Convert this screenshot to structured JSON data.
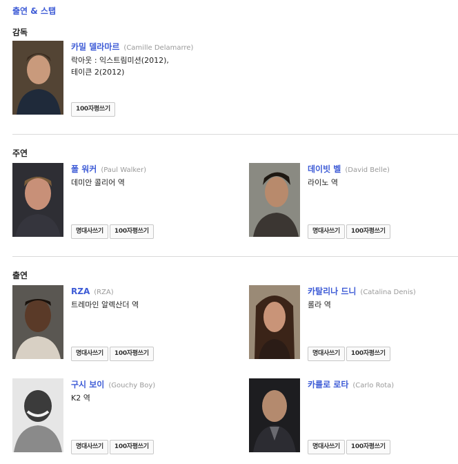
{
  "section": {
    "title": "출연 & 스탭"
  },
  "groups": {
    "director": "감독",
    "lead": "주연",
    "cast": "출연"
  },
  "buttons": {
    "quote": "명대사쓰기",
    "review": "100자평쓰기"
  },
  "people": [
    {
      "name": "카밀 델라마르",
      "en": "(Camille Delamarre)",
      "line1": "락아웃 : 익스트림미션(2012),",
      "line2": "테이큰 2(2012)"
    },
    {
      "name": "폴 워커",
      "en": "(Paul Walker)",
      "line1": "데미안 콜리어 역"
    },
    {
      "name": "데이빗 벨",
      "en": "(David Belle)",
      "line1": "라이노 역"
    },
    {
      "name": "RZA",
      "en": "(RZA)",
      "line1": "트레마인 알렉산더 역"
    },
    {
      "name": "카탈리나 드니",
      "en": "(Catalina Denis)",
      "line1": "롤라 역"
    },
    {
      "name": "구시 보이",
      "en": "(Gouchy Boy)",
      "line1": "K2 역"
    },
    {
      "name": "카를로 로타",
      "en": "(Carlo Rota)",
      "line1": ""
    }
  ],
  "colors": {
    "accent": "#3d5bd6",
    "muted": "#999999",
    "divider": "#d9d9d9"
  }
}
